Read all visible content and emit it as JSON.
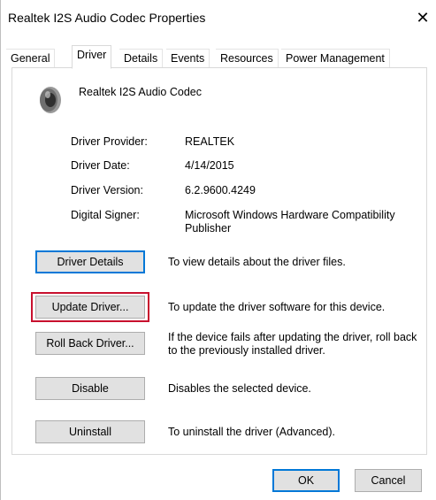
{
  "window": {
    "title": "Realtek I2S Audio Codec Properties",
    "close_glyph": "✕"
  },
  "tabs": [
    {
      "label": "General"
    },
    {
      "label": "Driver"
    },
    {
      "label": "Details"
    },
    {
      "label": "Events"
    },
    {
      "label": "Resources"
    },
    {
      "label": "Power Management"
    }
  ],
  "active_tab": "Driver",
  "device": {
    "icon": "speaker-icon",
    "name": "Realtek I2S Audio Codec"
  },
  "driver_info": [
    {
      "label": "Driver Provider:",
      "value": "REALTEK"
    },
    {
      "label": "Driver Date:",
      "value": "4/14/2015"
    },
    {
      "label": "Driver Version:",
      "value": "6.2.9600.4249"
    },
    {
      "label": "Digital Signer:",
      "value": "Microsoft Windows Hardware Compatibility Publisher"
    }
  ],
  "actions": [
    {
      "button": "Driver Details",
      "description": "To view details about the driver files."
    },
    {
      "button": "Update Driver...",
      "description": "To update the driver software for this device."
    },
    {
      "button": "Roll Back Driver...",
      "description": "If the device fails after updating the driver, roll back to the previously installed driver."
    },
    {
      "button": "Disable",
      "description": "Disables the selected device."
    },
    {
      "button": "Uninstall",
      "description": "To uninstall the driver (Advanced)."
    }
  ],
  "footer": {
    "ok_label": "OK",
    "cancel_label": "Cancel"
  },
  "colors": {
    "highlight": "#c8102e",
    "focus": "#0078d7",
    "button_face": "#e1e1e1"
  }
}
